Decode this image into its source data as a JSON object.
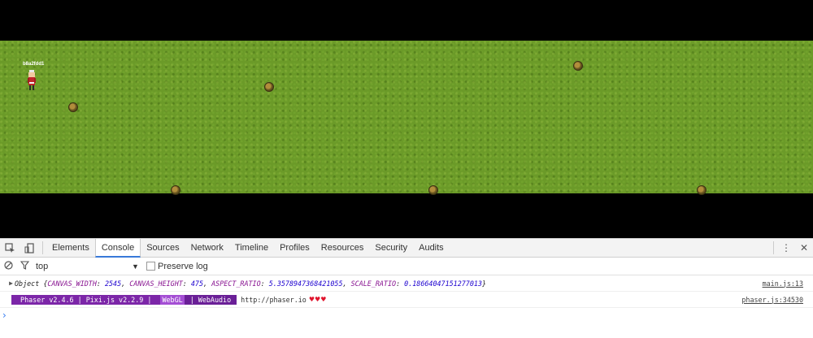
{
  "game": {
    "player_name": "b8a2fdd1"
  },
  "devtools": {
    "tabs": [
      "Elements",
      "Console",
      "Sources",
      "Network",
      "Timeline",
      "Profiles",
      "Resources",
      "Security",
      "Audits"
    ],
    "active_tab": "Console",
    "filter": {
      "context": "top",
      "preserve_log_label": "Preserve log"
    },
    "console": {
      "object_prefix": "Object",
      "object_open": "{",
      "object_close": "}",
      "fields": [
        {
          "key": "CANVAS_WIDTH",
          "value": "2545"
        },
        {
          "key": "CANVAS_HEIGHT",
          "value": "475"
        },
        {
          "key": "ASPECT_RATIO",
          "value": "5.3578947368421055"
        },
        {
          "key": "SCALE_RATIO",
          "value": "0.18664047151277013"
        }
      ],
      "object_source": "main.js:13",
      "banner_part1": " Phaser v2.4.6 | Pixi.js v2.2.9 | ",
      "banner_part2": "WebGL",
      "banner_part3": " | WebAudio ",
      "banner_url": "http://phaser.io",
      "banner_hearts": "♥♥♥",
      "banner_source": "phaser.js:34530",
      "prompt": "›"
    },
    "icons": {
      "inspect": "inspect-icon",
      "device": "device-mode-icon",
      "clear": "clear-console-icon",
      "filter": "filter-icon",
      "more": "more-vert-icon",
      "close": "close-icon"
    }
  }
}
